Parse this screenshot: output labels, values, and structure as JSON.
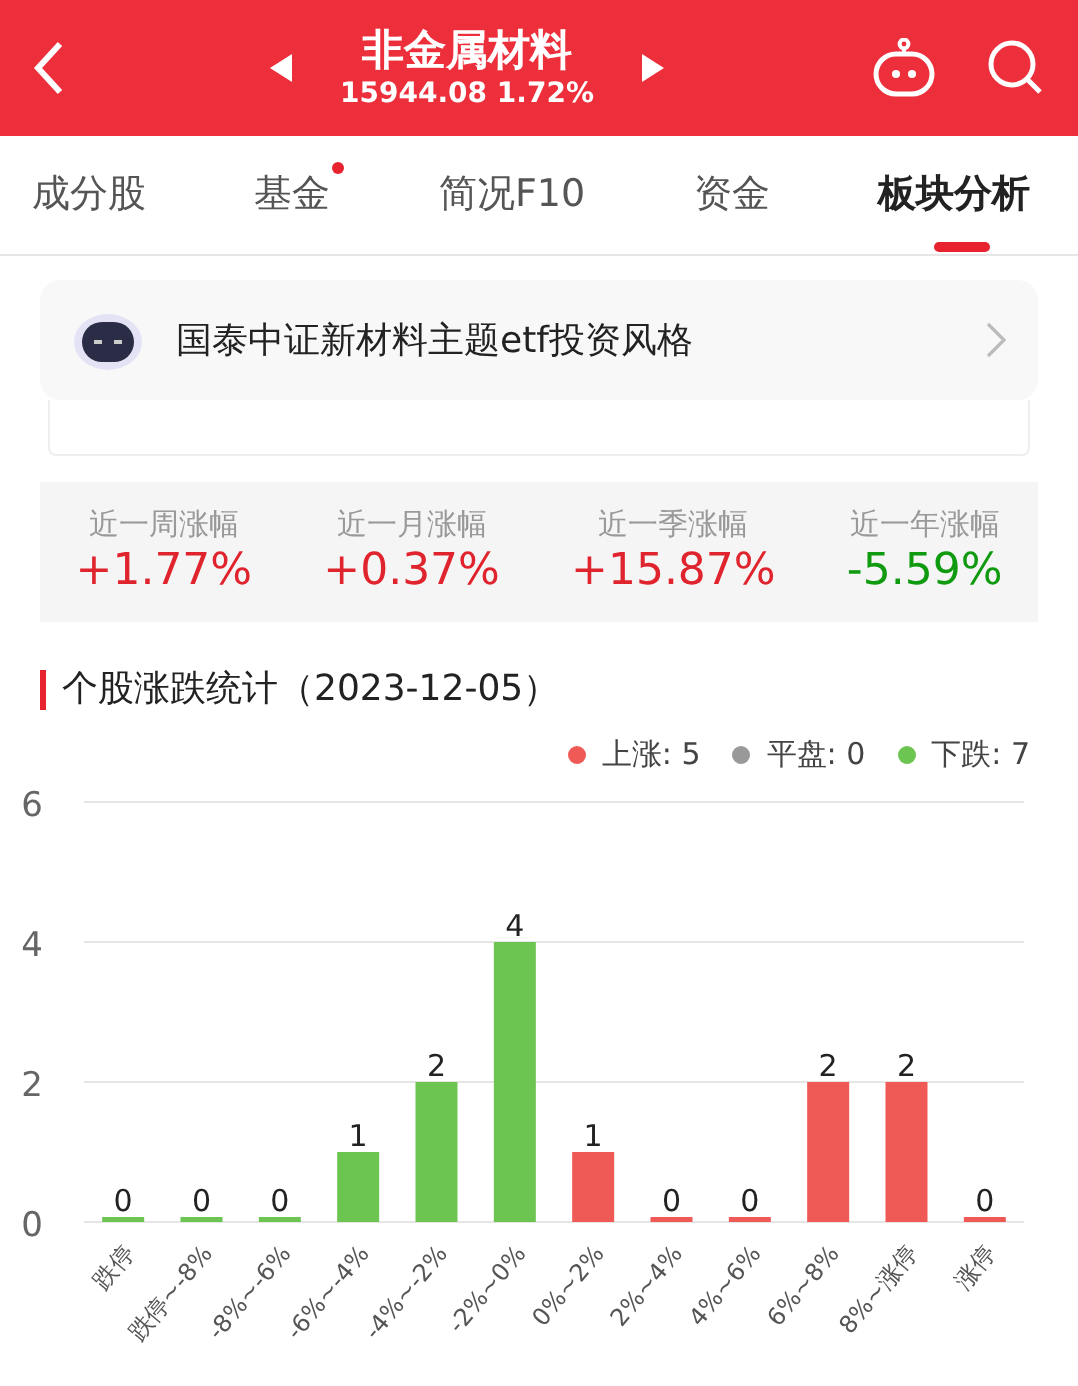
{
  "header": {
    "title": "非金属材料",
    "quote": "15944.08 1.72%"
  },
  "tabs": [
    {
      "label": "成分股",
      "selected": false,
      "dot": false
    },
    {
      "label": "基金",
      "selected": false,
      "dot": true
    },
    {
      "label": "简况F10",
      "selected": false,
      "dot": false
    },
    {
      "label": "资金",
      "selected": false,
      "dot": false
    },
    {
      "label": "板块分析",
      "selected": true,
      "dot": false
    }
  ],
  "banner": {
    "text": "国泰中证新材料主题etf投资风格"
  },
  "stats": [
    {
      "label": "近一周涨幅",
      "value": "+1.77%",
      "color": "#e0242d"
    },
    {
      "label": "近一月涨幅",
      "value": "+0.37%",
      "color": "#e0242d"
    },
    {
      "label": "近一季涨幅",
      "value": "+15.87%",
      "color": "#e0242d"
    },
    {
      "label": "近一年涨幅",
      "value": "-5.59%",
      "color": "#109a10"
    }
  ],
  "section": {
    "title": "个股涨跌统计（2023-12-05）"
  },
  "legend": [
    {
      "label": "上涨: 5",
      "color": "#f05a56"
    },
    {
      "label": "平盘: 0",
      "color": "#999999"
    },
    {
      "label": "下跌: 7",
      "color": "#6cc551"
    }
  ],
  "chart": {
    "chart_data": {
      "type": "bar",
      "stacked": true,
      "data_labels": true,
      "ylim": [
        0,
        6
      ],
      "yticks": [
        0,
        2,
        4,
        6
      ],
      "categories": [
        "跌停",
        "跌停~-8%",
        "-8%~-6%",
        "-6%~-4%",
        "-4%~-2%",
        "-2%~0%",
        "0%~2%",
        "2%~4%",
        "4%~6%",
        "6%~8%",
        "8%~涨停",
        "涨停"
      ],
      "series": [
        {
          "color": "#6cc551",
          "values": [
            0,
            0,
            0,
            1,
            2,
            4,
            null,
            null,
            null,
            null,
            null,
            null
          ]
        },
        {
          "color": "#f05a56",
          "values": [
            null,
            null,
            null,
            null,
            null,
            null,
            1,
            0,
            0,
            2,
            2,
            0
          ]
        }
      ]
    }
  }
}
